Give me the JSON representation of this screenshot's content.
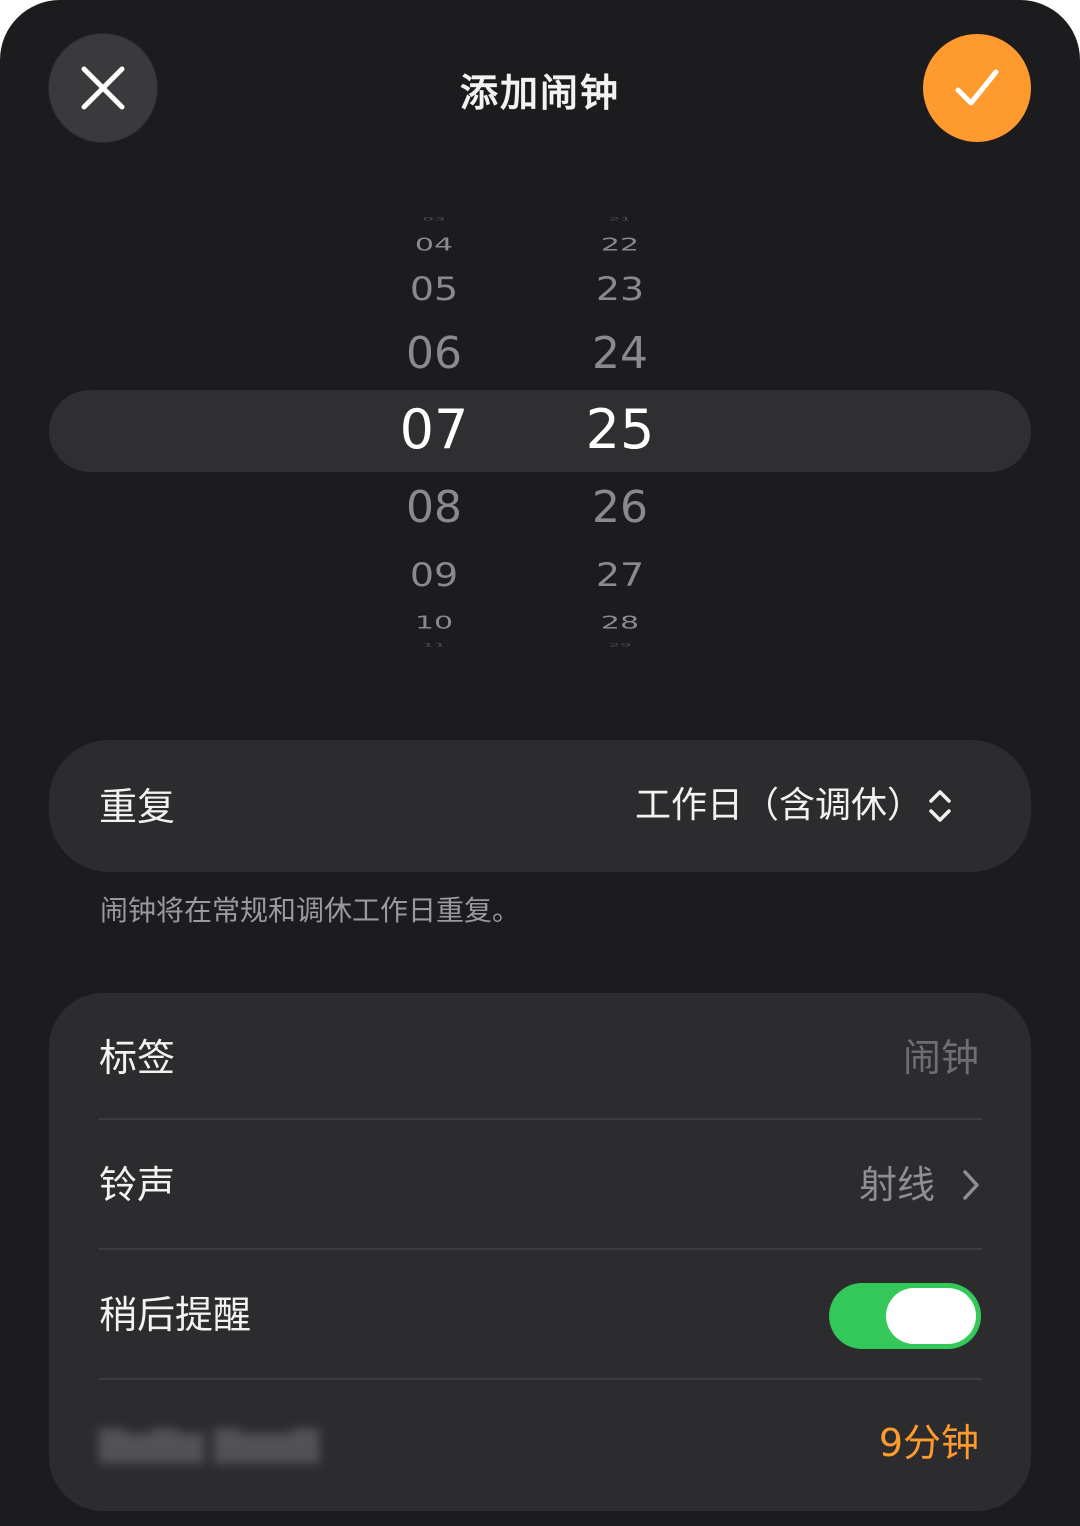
{
  "header": {
    "title": "添加闹钟",
    "close_icon": "close-icon",
    "confirm_icon": "checkmark-icon",
    "confirm_color": "#ff9a2f"
  },
  "picker": {
    "hours": [
      "03",
      "04",
      "05",
      "06",
      "07",
      "08",
      "09",
      "10",
      "11"
    ],
    "minutes": [
      "21",
      "22",
      "23",
      "24",
      "25",
      "26",
      "27",
      "28",
      "29"
    ],
    "selected_hour": "07",
    "selected_minute": "25"
  },
  "repeat": {
    "label": "重复",
    "value": "工作日（含调休）",
    "icon": "chevron-up-down-icon",
    "footnote": "闹钟将在常规和调休工作日重复。"
  },
  "settings": {
    "label_row": {
      "label": "标签",
      "placeholder": "闹钟"
    },
    "ringtone_row": {
      "label": "铃声",
      "value": "射线",
      "icon": "chevron-right-icon"
    },
    "snooze_row": {
      "label": "稍后提醒",
      "enabled": true,
      "toggle_color": "#34c759"
    },
    "snooze_duration_row": {
      "value": "9分钟",
      "color": "#ff9a2f"
    }
  }
}
